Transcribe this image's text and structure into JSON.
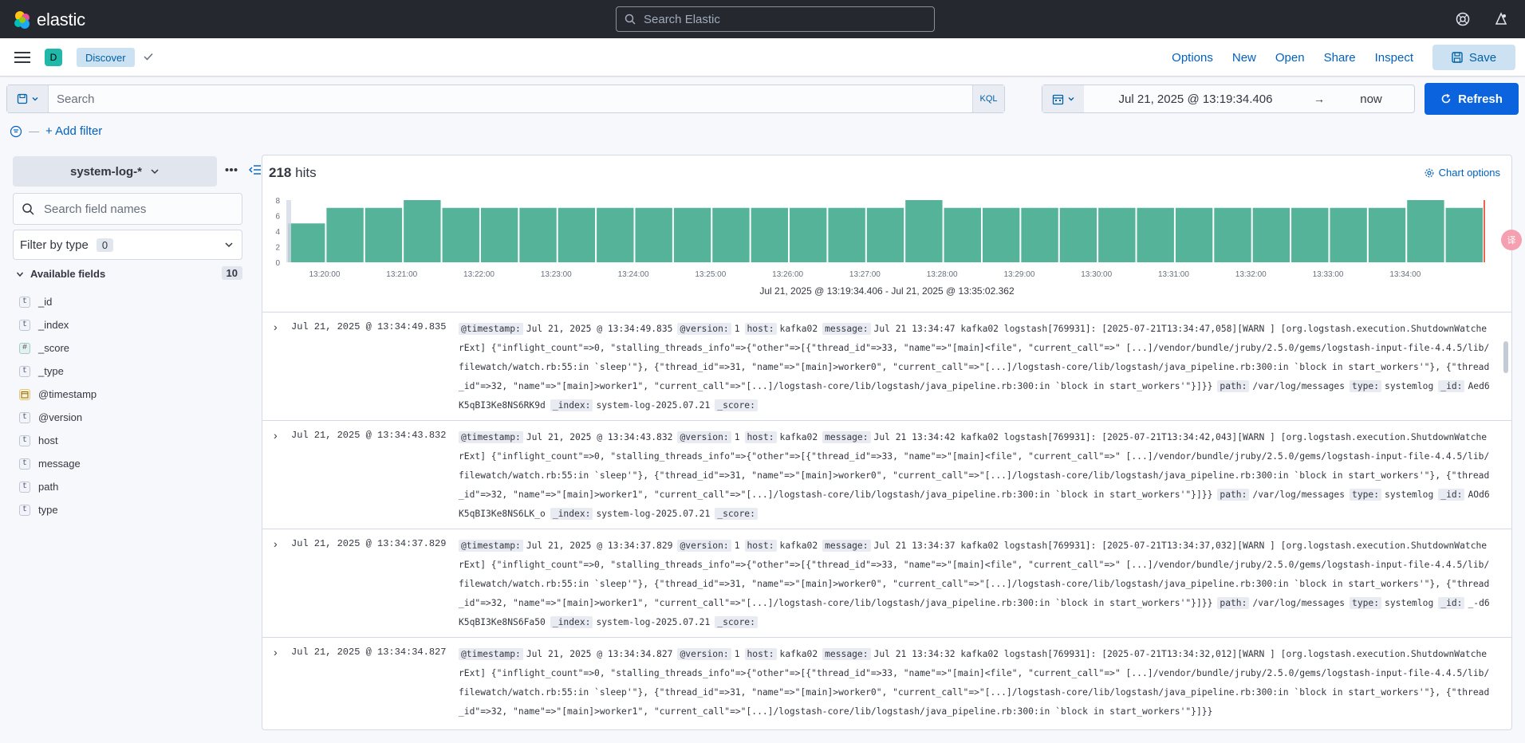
{
  "topbar": {
    "logo_text": "elastic",
    "search_placeholder": "Search Elastic"
  },
  "appbar": {
    "space_initial": "D",
    "breadcrumb": "Discover",
    "links": [
      "Options",
      "New",
      "Open",
      "Share",
      "Inspect"
    ],
    "save_label": "Save"
  },
  "query": {
    "placeholder": "Search",
    "language": "KQL",
    "start": "Jul 21, 2025 @ 13:19:34.406",
    "arrow": "→",
    "end": "now",
    "refresh_label": "Refresh",
    "add_filter": "+ Add filter"
  },
  "sidebar": {
    "index_pattern": "system-log-*",
    "field_search_placeholder": "Search field names",
    "filter_by_type": "Filter by type",
    "filter_count": "0",
    "available_label": "Available fields",
    "available_count": "10",
    "fields": [
      {
        "type": "t",
        "name": "_id"
      },
      {
        "type": "t",
        "name": "_index"
      },
      {
        "type": "#",
        "name": "_score"
      },
      {
        "type": "t",
        "name": "_type"
      },
      {
        "type": "date",
        "name": "@timestamp"
      },
      {
        "type": "t",
        "name": "@version"
      },
      {
        "type": "t",
        "name": "host"
      },
      {
        "type": "t",
        "name": "message"
      },
      {
        "type": "t",
        "name": "path"
      },
      {
        "type": "t",
        "name": "type"
      }
    ]
  },
  "main": {
    "hits_count": "218",
    "hits_label": "hits",
    "chart_options": "Chart options",
    "range_label": "Jul 21, 2025 @ 13:19:34.406 - Jul 21, 2025 @ 13:35:02.362"
  },
  "chart_data": {
    "type": "bar",
    "x_ticks": [
      "13:20:00",
      "13:21:00",
      "13:22:00",
      "13:23:00",
      "13:24:00",
      "13:25:00",
      "13:26:00",
      "13:27:00",
      "13:28:00",
      "13:29:00",
      "13:30:00",
      "13:31:00",
      "13:32:00",
      "13:33:00",
      "13:34:00"
    ],
    "y_ticks": [
      0,
      2,
      4,
      6,
      8
    ],
    "ylim": [
      0,
      8
    ],
    "values": [
      5,
      7,
      7,
      8,
      7,
      7,
      7,
      7,
      7,
      7,
      7,
      7,
      7,
      7,
      7,
      7,
      8,
      7,
      7,
      7,
      7,
      7,
      7,
      7,
      7,
      7,
      7,
      7,
      7,
      8,
      7
    ],
    "bar_color": "#54b399",
    "now_marker_color": "#e7664c"
  },
  "documents": [
    {
      "time": "Jul 21, 2025 @ 13:34:49.835",
      "fields": [
        {
          "k": "@timestamp:",
          "v": "Jul 21, 2025 @ 13:34:49.835"
        },
        {
          "k": "@version:",
          "v": "1"
        },
        {
          "k": "host:",
          "v": "kafka02"
        },
        {
          "k": "message:",
          "v": "Jul 21 13:34:47 kafka02 logstash[769931]: [2025-07-21T13:34:47,058][WARN ] [org.logstash.execution.ShutdownWatcherExt] {\"inflight_count\"=>0, \"stalling_threads_info\"=>{\"other\"=>[{\"thread_id\"=>33, \"name\"=>\"[main]<file\", \"current_call\"=>\" [...]/vendor/bundle/jruby/2.5.0/gems/logstash-input-file-4.4.5/lib/filewatch/watch.rb:55:in `sleep'\"}, {\"thread_id\"=>31, \"name\"=>\"[main]>worker0\", \"current_call\"=>\"[...]/logstash-core/lib/logstash/java_pipeline.rb:300:in `block in start_workers'\"}, {\"thread_id\"=>32, \"name\"=>\"[main]>worker1\", \"current_call\"=>\"[...]/logstash-core/lib/logstash/java_pipeline.rb:300:in `block in start_workers'\"}]}}"
        },
        {
          "k": "path:",
          "v": "/var/log/messages"
        },
        {
          "k": "type:",
          "v": "systemlog"
        },
        {
          "k": "_id:",
          "v": "Aed6K5qBI3Ke8NS6RK9d"
        },
        {
          "k": "_index:",
          "v": "system-log-2025.07.21"
        },
        {
          "k": "_score:",
          "v": ""
        }
      ]
    },
    {
      "time": "Jul 21, 2025 @ 13:34:43.832",
      "fields": [
        {
          "k": "@timestamp:",
          "v": "Jul 21, 2025 @ 13:34:43.832"
        },
        {
          "k": "@version:",
          "v": "1"
        },
        {
          "k": "host:",
          "v": "kafka02"
        },
        {
          "k": "message:",
          "v": "Jul 21 13:34:42 kafka02 logstash[769931]: [2025-07-21T13:34:42,043][WARN ] [org.logstash.execution.ShutdownWatcherExt] {\"inflight_count\"=>0, \"stalling_threads_info\"=>{\"other\"=>[{\"thread_id\"=>33, \"name\"=>\"[main]<file\", \"current_call\"=>\" [...]/vendor/bundle/jruby/2.5.0/gems/logstash-input-file-4.4.5/lib/filewatch/watch.rb:55:in `sleep'\"}, {\"thread_id\"=>31, \"name\"=>\"[main]>worker0\", \"current_call\"=>\"[...]/logstash-core/lib/logstash/java_pipeline.rb:300:in `block in start_workers'\"}, {\"thread_id\"=>32, \"name\"=>\"[main]>worker1\", \"current_call\"=>\"[...]/logstash-core/lib/logstash/java_pipeline.rb:300:in `block in start_workers'\"}]}}"
        },
        {
          "k": "path:",
          "v": "/var/log/messages"
        },
        {
          "k": "type:",
          "v": "systemlog"
        },
        {
          "k": "_id:",
          "v": "AOd6K5qBI3Ke8NS6LK_o"
        },
        {
          "k": "_index:",
          "v": "system-log-2025.07.21"
        },
        {
          "k": "_score:",
          "v": ""
        }
      ]
    },
    {
      "time": "Jul 21, 2025 @ 13:34:37.829",
      "fields": [
        {
          "k": "@timestamp:",
          "v": "Jul 21, 2025 @ 13:34:37.829"
        },
        {
          "k": "@version:",
          "v": "1"
        },
        {
          "k": "host:",
          "v": "kafka02"
        },
        {
          "k": "message:",
          "v": "Jul 21 13:34:37 kafka02 logstash[769931]: [2025-07-21T13:34:37,032][WARN ] [org.logstash.execution.ShutdownWatcherExt] {\"inflight_count\"=>0, \"stalling_threads_info\"=>{\"other\"=>[{\"thread_id\"=>33, \"name\"=>\"[main]<file\", \"current_call\"=>\" [...]/vendor/bundle/jruby/2.5.0/gems/logstash-input-file-4.4.5/lib/filewatch/watch.rb:55:in `sleep'\"}, {\"thread_id\"=>31, \"name\"=>\"[main]>worker0\", \"current_call\"=>\"[...]/logstash-core/lib/logstash/java_pipeline.rb:300:in `block in start_workers'\"}, {\"thread_id\"=>32, \"name\"=>\"[main]>worker1\", \"current_call\"=>\"[...]/logstash-core/lib/logstash/java_pipeline.rb:300:in `block in start_workers'\"}]}}"
        },
        {
          "k": "path:",
          "v": "/var/log/messages"
        },
        {
          "k": "type:",
          "v": "systemlog"
        },
        {
          "k": "_id:",
          "v": "_-d6K5qBI3Ke8NS6Fa50"
        },
        {
          "k": "_index:",
          "v": "system-log-2025.07.21"
        },
        {
          "k": "_score:",
          "v": ""
        }
      ]
    },
    {
      "time": "Jul 21, 2025 @ 13:34:34.827",
      "fields": [
        {
          "k": "@timestamp:",
          "v": "Jul 21, 2025 @ 13:34:34.827"
        },
        {
          "k": "@version:",
          "v": "1"
        },
        {
          "k": "host:",
          "v": "kafka02"
        },
        {
          "k": "message:",
          "v": "Jul 21 13:34:32 kafka02 logstash[769931]: [2025-07-21T13:34:32,012][WARN ] [org.logstash.execution.ShutdownWatcherExt] {\"inflight_count\"=>0, \"stalling_threads_info\"=>{\"other\"=>[{\"thread_id\"=>33, \"name\"=>\"[main]<file\", \"current_call\"=>\" [...]/vendor/bundle/jruby/2.5.0/gems/logstash-input-file-4.4.5/lib/filewatch/watch.rb:55:in `sleep'\"}, {\"thread_id\"=>31, \"name\"=>\"[main]>worker0\", \"current_call\"=>\"[...]/logstash-core/lib/logstash/java_pipeline.rb:300:in `block in start_workers'\"}, {\"thread_id\"=>32, \"name\"=>\"[main]>worker1\", \"current_call\"=>\"[...]/logstash-core/lib/logstash/java_pipeline.rb:300:in `block in start_workers'\"}]}}"
        }
      ]
    }
  ]
}
